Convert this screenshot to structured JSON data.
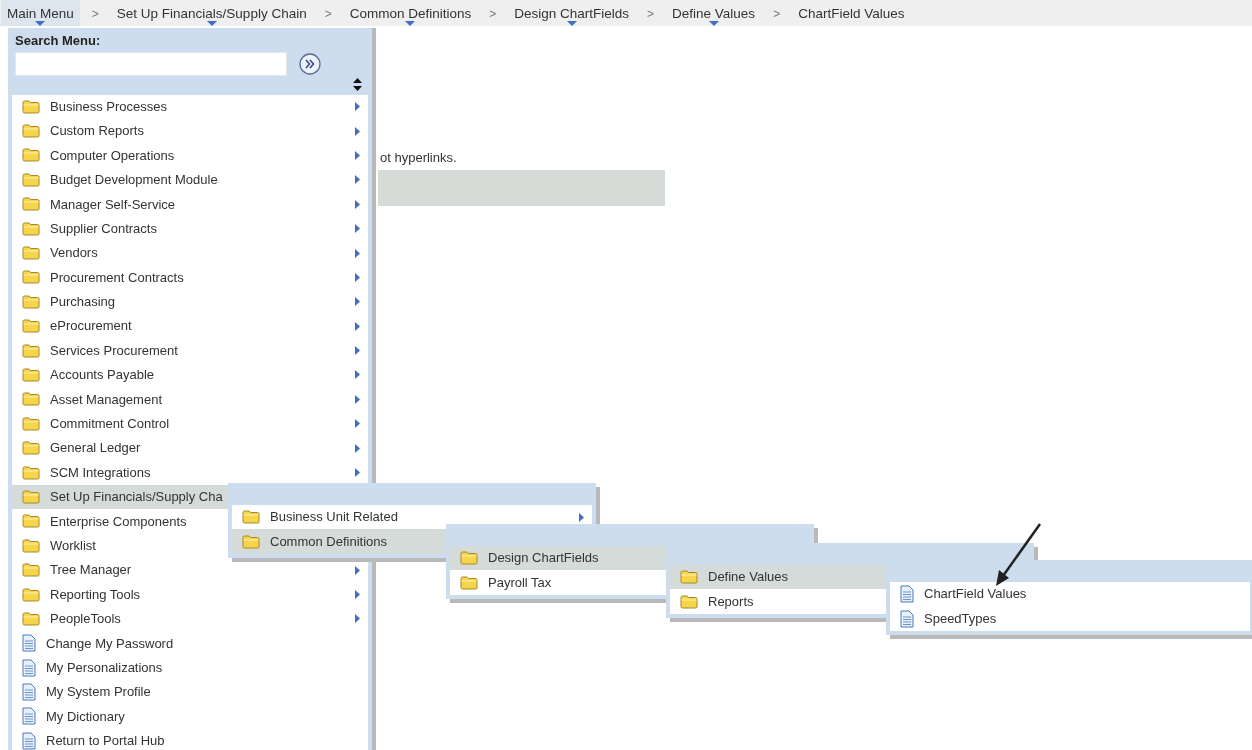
{
  "breadcrumbs": [
    {
      "label": "Main Menu",
      "has_dropdown": true,
      "selected": true
    },
    {
      "separator": ">",
      "label": "Set Up Financials/Supply Chain",
      "has_dropdown": true,
      "selected": false
    },
    {
      "separator": ">",
      "label": "Common Definitions",
      "has_dropdown": true,
      "selected": false
    },
    {
      "separator": ">",
      "label": "Design ChartFields",
      "has_dropdown": true,
      "selected": false
    },
    {
      "separator": ">",
      "label": "Define Values",
      "has_dropdown": true,
      "selected": false
    },
    {
      "separator": ">",
      "label": "ChartField Values",
      "has_dropdown": false,
      "selected": false
    }
  ],
  "page": {
    "text": "ot hyperlinks."
  },
  "main_menu": {
    "search_label": "Search Menu:",
    "items": [
      {
        "label": "Business Processes",
        "kind": "folder",
        "has_arrow": true,
        "selected": false
      },
      {
        "label": "Custom Reports",
        "kind": "folder",
        "has_arrow": true,
        "selected": false
      },
      {
        "label": "Computer Operations",
        "kind": "folder",
        "has_arrow": true,
        "selected": false
      },
      {
        "label": "Budget Development Module",
        "kind": "folder",
        "has_arrow": true,
        "selected": false
      },
      {
        "label": "Manager Self-Service",
        "kind": "folder",
        "has_arrow": true,
        "selected": false
      },
      {
        "label": "Supplier Contracts",
        "kind": "folder",
        "has_arrow": true,
        "selected": false
      },
      {
        "label": "Vendors",
        "kind": "folder",
        "has_arrow": true,
        "selected": false
      },
      {
        "label": "Procurement Contracts",
        "kind": "folder",
        "has_arrow": true,
        "selected": false
      },
      {
        "label": "Purchasing",
        "kind": "folder",
        "has_arrow": true,
        "selected": false
      },
      {
        "label": "eProcurement",
        "kind": "folder",
        "has_arrow": true,
        "selected": false
      },
      {
        "label": "Services Procurement",
        "kind": "folder",
        "has_arrow": true,
        "selected": false
      },
      {
        "label": "Accounts Payable",
        "kind": "folder",
        "has_arrow": true,
        "selected": false
      },
      {
        "label": "Asset Management",
        "kind": "folder",
        "has_arrow": true,
        "selected": false
      },
      {
        "label": "Commitment Control",
        "kind": "folder",
        "has_arrow": true,
        "selected": false
      },
      {
        "label": "General Ledger",
        "kind": "folder",
        "has_arrow": true,
        "selected": false
      },
      {
        "label": "SCM Integrations",
        "kind": "folder",
        "has_arrow": true,
        "selected": false
      },
      {
        "label": "Set Up Financials/Supply Cha",
        "kind": "folder",
        "has_arrow": false,
        "selected": true
      },
      {
        "label": "Enterprise Components",
        "kind": "folder",
        "has_arrow": false,
        "selected": false
      },
      {
        "label": "Worklist",
        "kind": "folder",
        "has_arrow": false,
        "selected": false
      },
      {
        "label": "Tree Manager",
        "kind": "folder",
        "has_arrow": true,
        "selected": false
      },
      {
        "label": "Reporting Tools",
        "kind": "folder",
        "has_arrow": true,
        "selected": false
      },
      {
        "label": "PeopleTools",
        "kind": "folder",
        "has_arrow": true,
        "selected": false
      },
      {
        "label": "Change My Password",
        "kind": "page",
        "has_arrow": false,
        "selected": false
      },
      {
        "label": "My Personalizations",
        "kind": "page",
        "has_arrow": false,
        "selected": false
      },
      {
        "label": "My System Profile",
        "kind": "page",
        "has_arrow": false,
        "selected": false
      },
      {
        "label": "My Dictionary",
        "kind": "page",
        "has_arrow": false,
        "selected": false
      },
      {
        "label": "Return to Portal Hub",
        "kind": "page",
        "has_arrow": false,
        "selected": false
      }
    ]
  },
  "submenus": [
    {
      "items": [
        {
          "label": "Business Unit Related",
          "kind": "folder",
          "has_arrow": true,
          "selected": false
        },
        {
          "label": "Common Definitions",
          "kind": "folder",
          "has_arrow": false,
          "selected": true
        }
      ]
    },
    {
      "items": [
        {
          "label": "Design ChartFields",
          "kind": "folder",
          "has_arrow": false,
          "selected": true
        },
        {
          "label": "Payroll Tax",
          "kind": "folder",
          "has_arrow": false,
          "selected": false
        }
      ]
    },
    {
      "items": [
        {
          "label": "Define Values",
          "kind": "folder",
          "has_arrow": false,
          "selected": true
        },
        {
          "label": "Reports",
          "kind": "folder",
          "has_arrow": false,
          "selected": false
        }
      ]
    },
    {
      "items": [
        {
          "label": "ChartField Values",
          "kind": "page",
          "has_arrow": false,
          "selected": false
        },
        {
          "label": "SpeedTypes",
          "kind": "page",
          "has_arrow": false,
          "selected": false
        }
      ]
    }
  ]
}
